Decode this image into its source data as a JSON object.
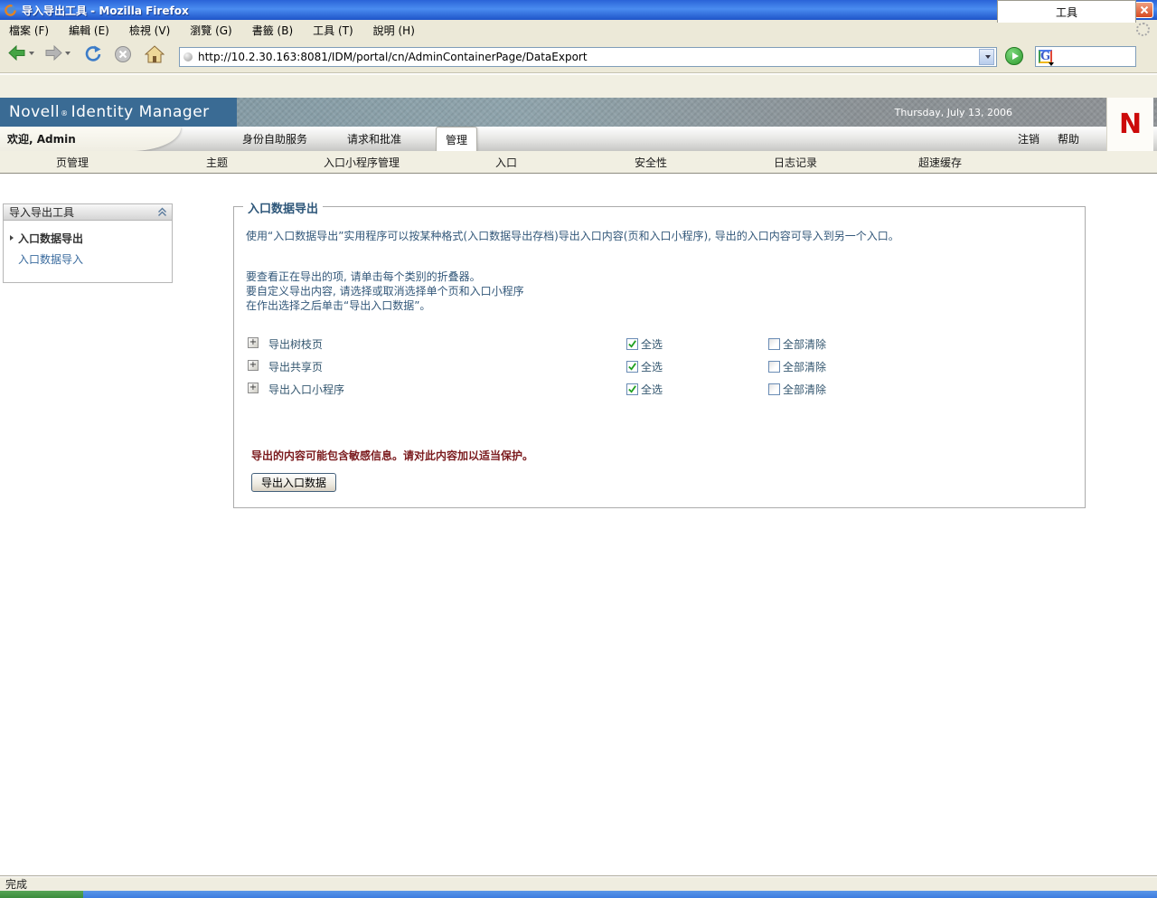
{
  "window": {
    "title": "导入导出工具 - Mozilla Firefox"
  },
  "menubar": {
    "items": [
      {
        "label": "檔案 (F)"
      },
      {
        "label": "編輯 (E)"
      },
      {
        "label": "檢視 (V)"
      },
      {
        "label": "瀏覽 (G)"
      },
      {
        "label": "書籤 (B)"
      },
      {
        "label": "工具 (T)"
      },
      {
        "label": "說明 (H)"
      }
    ]
  },
  "toolbar": {
    "url": "http://10.2.30.163:8081/IDM/portal/cn/AdminContainerPage/DataExport",
    "search_engine": "G"
  },
  "banner": {
    "brand": "Novell",
    "reg": "®",
    "product": "Identity Manager",
    "date": "Thursday, July 13, 2006",
    "logo_letter": "N",
    "brand_bg": "#3A6B94"
  },
  "tabs_row": {
    "welcome": "欢迎, Admin",
    "tabs": [
      {
        "label": "身份自助服务",
        "active": false
      },
      {
        "label": "请求和批准",
        "active": false
      },
      {
        "label": "管理",
        "active": true
      }
    ],
    "links": [
      {
        "label": "注销"
      },
      {
        "label": "帮助"
      }
    ]
  },
  "subtabs": {
    "items": [
      {
        "label": "页管理",
        "active": false
      },
      {
        "label": "主题",
        "active": false
      },
      {
        "label": "入口小程序管理",
        "active": false
      },
      {
        "label": "入口",
        "active": false
      },
      {
        "label": "安全性",
        "active": false
      },
      {
        "label": "日志记录",
        "active": false
      },
      {
        "label": "超速缓存",
        "active": false
      },
      {
        "label": "工具",
        "active": true
      }
    ]
  },
  "sidebar": {
    "title": "导入导出工具",
    "items": [
      {
        "label": "入口数据导出",
        "current": true
      },
      {
        "label": "入口数据导入",
        "current": false
      }
    ]
  },
  "main": {
    "legend": "入口数据导出",
    "intro": "使用“入口数据导出”实用程序可以按某种格式(入口数据导出存档)导出入口内容(页和入口小程序), 导出的入口内容可导入到另一个入口。",
    "instructions": [
      "要查看正在导出的项, 请单击每个类别的折叠器。",
      "要自定义导出内容, 请选择或取消选择单个页和入口小程序",
      "在作出选择之后单击“导出入口数据”。"
    ],
    "rows": [
      {
        "label": "导出树枝页",
        "select_all": "全选",
        "clear_all": "全部清除",
        "select_checked": true,
        "clear_checked": false
      },
      {
        "label": "导出共享页",
        "select_all": "全选",
        "clear_all": "全部清除",
        "select_checked": true,
        "clear_checked": false
      },
      {
        "label": "导出入口小程序",
        "select_all": "全选",
        "clear_all": "全部清除",
        "select_checked": true,
        "clear_checked": false
      }
    ],
    "warning": "导出的内容可能包含敏感信息。请对此内容加以适当保护。",
    "export_button": "导出入口数据",
    "warning_color": "#7B1B1E",
    "text_color": "#33587A"
  },
  "statusbar": {
    "text": "完成"
  }
}
